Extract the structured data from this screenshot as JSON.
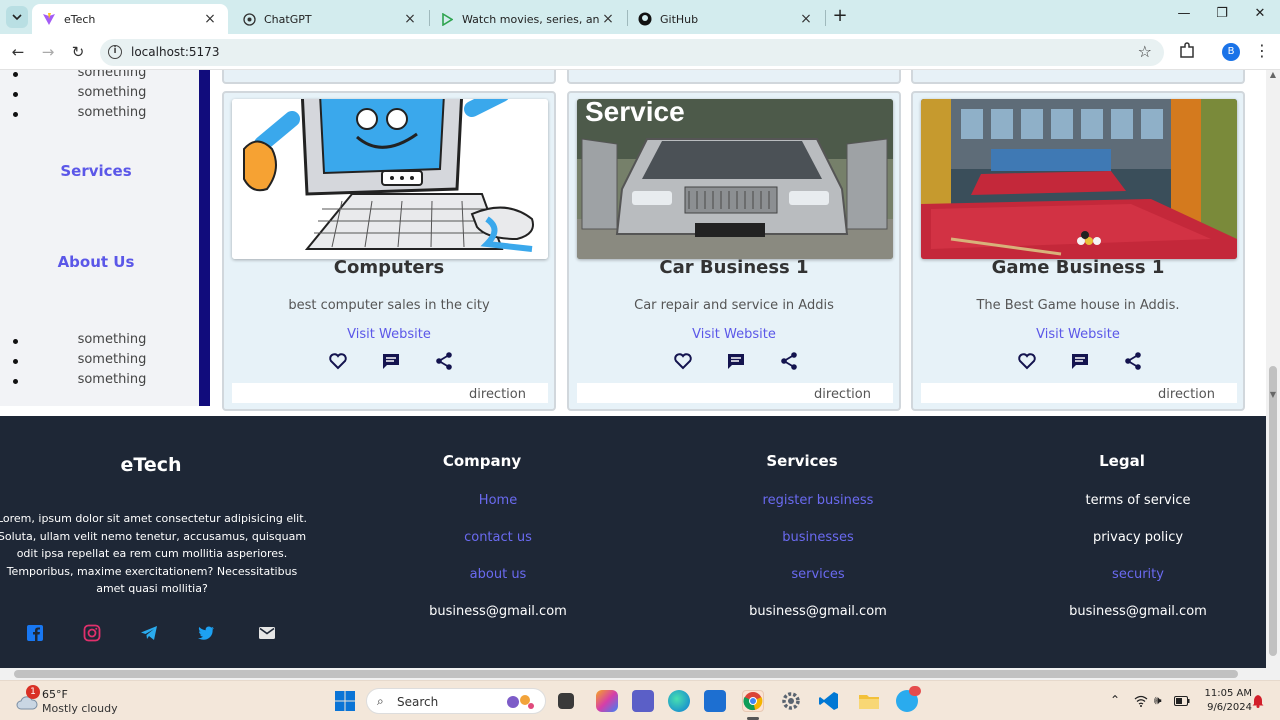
{
  "browser": {
    "tabs": [
      {
        "title": "eTech",
        "active": true
      },
      {
        "title": "ChatGPT",
        "active": false
      },
      {
        "title": "Watch movies, series, animes o",
        "active": false
      },
      {
        "title": "GitHub",
        "active": false
      }
    ],
    "url": "localhost:5173",
    "profile_initial": "B"
  },
  "sidebar": {
    "top_items": [
      "something",
      "something",
      "something"
    ],
    "links": [
      "Services",
      "About Us"
    ],
    "bottom_items": [
      "something",
      "something",
      "something"
    ]
  },
  "cards": [
    {
      "name": "Computers",
      "description": "best computer sales in the city",
      "link": "Visit Website",
      "direction": "direction",
      "image": "cartoon-computer"
    },
    {
      "name": "Car Business 1",
      "description": "Car repair and service in Addis",
      "link": "Visit Website",
      "direction": "direction",
      "image": "car-service",
      "image_text": "Service"
    },
    {
      "name": "Game Business 1",
      "description": "The Best Game house in Addis.",
      "link": "Visit Website",
      "direction": "direction",
      "image": "pool-hall"
    }
  ],
  "footer": {
    "brand": "eTech",
    "about": "Lorem, ipsum dolor sit amet consectetur adipisicing elit. Soluta, ullam velit nemo tenetur, accusamus, quisquam odit ipsa repellat ea rem cum mollitia asperiores. Temporibus, maxime exercitationem? Necessitatibus amet quasi mollitia?",
    "social": [
      "facebook-icon",
      "instagram-icon",
      "telegram-icon",
      "twitter-icon",
      "mail-icon"
    ],
    "columns": [
      {
        "heading": "Company",
        "links": [
          "Home",
          "contact us",
          "about us"
        ],
        "email": "business@gmail.com"
      },
      {
        "heading": "Services",
        "links": [
          "register business",
          "businesses",
          "services"
        ],
        "email": "business@gmail.com"
      },
      {
        "heading": "Legal",
        "links": [
          "terms of service",
          "privacy policy",
          "security"
        ],
        "email": "business@gmail.com"
      }
    ]
  },
  "taskbar": {
    "weather_badge": "1",
    "temperature": "65°F",
    "condition": "Mostly cloudy",
    "search_label": "Search",
    "time": "11:05 AM",
    "date": "9/6/2024"
  },
  "colors": {
    "accent": "#5b57e8",
    "sidebar_edge": "#110c7c",
    "footer_bg": "#1e2736",
    "card_bg": "#e7f2f8"
  }
}
